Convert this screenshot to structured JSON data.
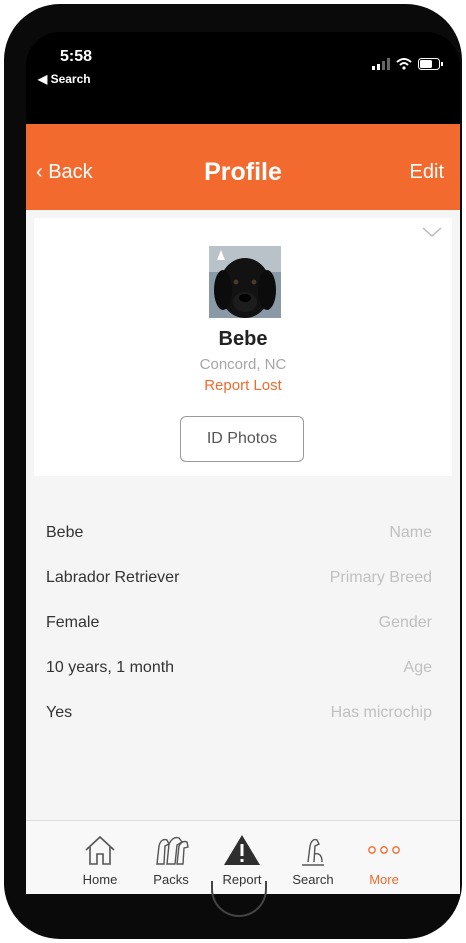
{
  "status_bar": {
    "time": "5:58",
    "back_app": "◀ Search"
  },
  "nav": {
    "back_label": "Back",
    "title": "Profile",
    "edit_label": "Edit"
  },
  "profile": {
    "name": "Bebe",
    "location": "Concord, NC",
    "report_lost": "Report Lost",
    "id_photos_label": "ID Photos"
  },
  "details": [
    {
      "value": "Bebe",
      "label": "Name"
    },
    {
      "value": "Labrador Retriever",
      "label": "Primary Breed"
    },
    {
      "value": "Female",
      "label": "Gender"
    },
    {
      "value": "10 years, 1 month",
      "label": "Age"
    },
    {
      "value": "Yes",
      "label": "Has microchip"
    }
  ],
  "tabs": [
    {
      "label": "Home",
      "icon": "home-icon"
    },
    {
      "label": "Packs",
      "icon": "packs-icon"
    },
    {
      "label": "Report",
      "icon": "report-warning-icon"
    },
    {
      "label": "Search",
      "icon": "search-dog-icon"
    },
    {
      "label": "More",
      "icon": "more-icon",
      "active": true
    }
  ],
  "colors": {
    "accent": "#f26a2e",
    "background": "#f5f5f5",
    "muted_text": "#c0c0c0"
  }
}
